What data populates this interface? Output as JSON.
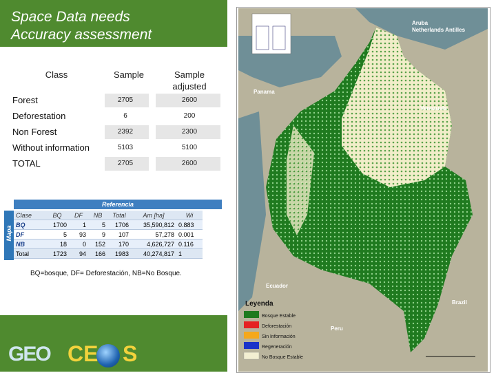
{
  "title": {
    "line1": "Space Data needs",
    "line2": "Accuracy assessment"
  },
  "sample_table": {
    "headers": {
      "class": "Class",
      "sample": "Sample",
      "sample_adjusted": "Sample adjusted"
    },
    "rows": [
      {
        "label": "Forest",
        "sample": "2705",
        "adjusted": "2600"
      },
      {
        "label": "Deforestation",
        "sample": "6",
        "adjusted": "200"
      },
      {
        "label": "Non Forest",
        "sample": "2392",
        "adjusted": "2300"
      },
      {
        "label": "Without information",
        "sample": "5103",
        "adjusted": "5100"
      },
      {
        "label": "TOTAL",
        "sample": "2705",
        "adjusted": "2600"
      }
    ]
  },
  "confusion_matrix": {
    "side_label": "Mapa",
    "top_label": "Referencia",
    "headers": [
      "Clase",
      "BQ",
      "DF",
      "NB",
      "Total",
      "Am [ha]",
      "Wi"
    ],
    "rows": [
      [
        "BQ",
        "1700",
        "1",
        "5",
        "1706",
        "35,590,812",
        "0.883"
      ],
      [
        "DF",
        "5",
        "93",
        "9",
        "107",
        "57,278",
        "0.001"
      ],
      [
        "NB",
        "18",
        "0",
        "152",
        "170",
        "4,626,727",
        "0.116"
      ],
      [
        "Total",
        "1723",
        "94",
        "166",
        "1983",
        "40,274,817",
        "1"
      ]
    ],
    "footnote": "BQ=bosque, DF= Deforestación, NB=No Bosque."
  },
  "logos": {
    "geo": "GEO",
    "ceos_c": "CE",
    "ceos_s": "S"
  },
  "map": {
    "labels": {
      "aruba": "Aruba",
      "antilles": "Netherlands Antilles",
      "panama": "Panama",
      "venezuela": "Venezuela",
      "ecuador": "Ecuador",
      "peru": "Peru",
      "brazil": "Brazil"
    },
    "legend_title": "Leyenda",
    "legend": [
      {
        "label": "Bosque Estable",
        "color": "#1f7a1f"
      },
      {
        "label": "Deforestación",
        "color": "#e52222"
      },
      {
        "label": "Sin Información",
        "color": "#f5a81b"
      },
      {
        "label": "Regeneración",
        "color": "#1a33c9"
      },
      {
        "label": "No Bosque Estable",
        "color": "#f3efd2"
      }
    ],
    "colors": {
      "forest": "#1f7a1f",
      "nonforest": "#f1edc9",
      "sea": "#6f8f97",
      "land": "#b9b39b"
    }
  }
}
